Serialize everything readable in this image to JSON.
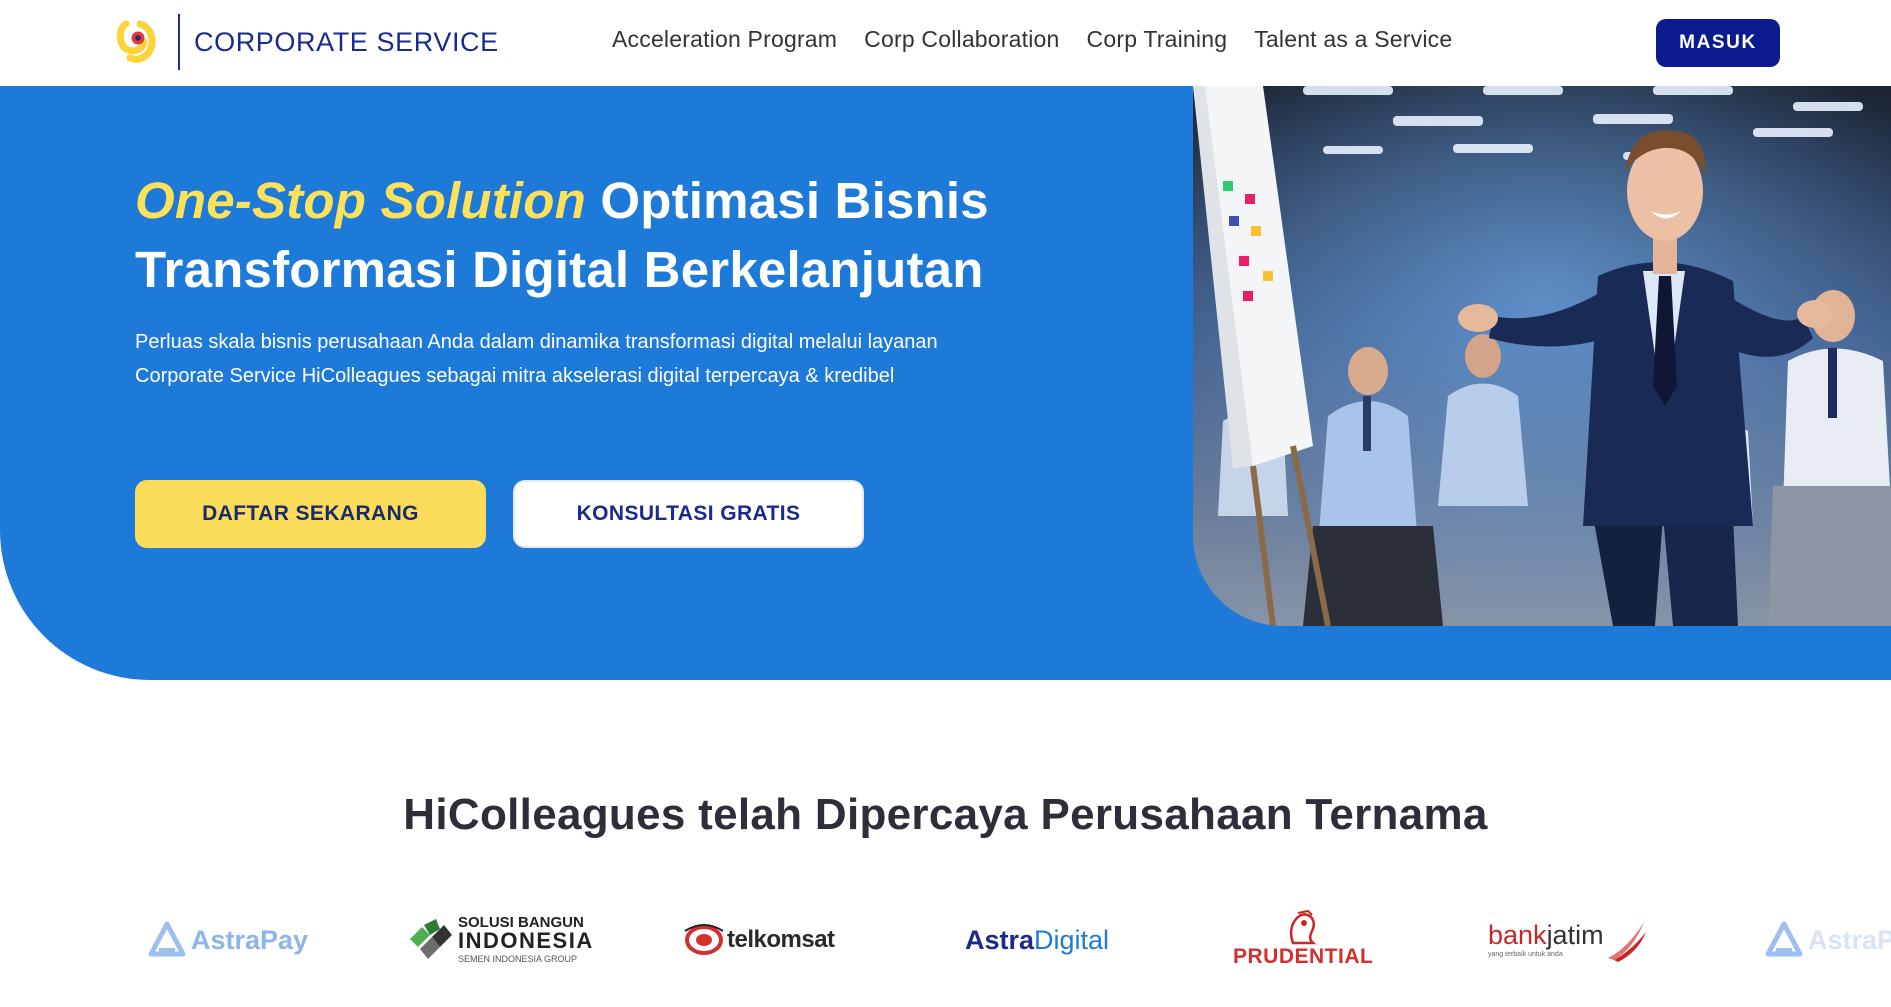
{
  "nav": {
    "brand": "CORPORATE SERVICE",
    "links": [
      "Acceleration Program",
      "Corp Collaboration",
      "Corp Training",
      "Talent as a Service"
    ],
    "login": "MASUK"
  },
  "hero": {
    "title_highlight": "One-Stop Solution",
    "title_rest_1": " Optimasi Bisnis",
    "title_line_2": "Transformasi Digital Berkelanjutan",
    "description": "Perluas skala bisnis perusahaan Anda dalam dinamika transformasi digital melalui layanan Corporate Service HiColleagues sebagai mitra akselerasi digital terpercaya & kredibel",
    "primary_cta": "DAFTAR SEKARANG",
    "secondary_cta": "KONSULTASI GRATIS"
  },
  "clients": {
    "title": "HiColleagues telah Dipercaya Perusahaan Ternama",
    "logos": {
      "astrapay": "AstraPay",
      "sbi_line1": "SOLUSI BANGUN",
      "sbi_line2": "INDONESIA",
      "sbi_line3": "SEMEN INDONESIA GROUP",
      "telkomsat": "telkomsat",
      "astradigital_a": "Astra",
      "astradigital_b": "Digital",
      "prudential": "PRUDENTIAL",
      "bankjatim_a": "bank",
      "bankjatim_b": "jatim",
      "bankjatim_tag": "yang terbaik untuk anda"
    }
  },
  "colors": {
    "primary_blue": "#1d7ad8",
    "navy": "#0b1a8c",
    "yellow": "#fbdc5a"
  }
}
